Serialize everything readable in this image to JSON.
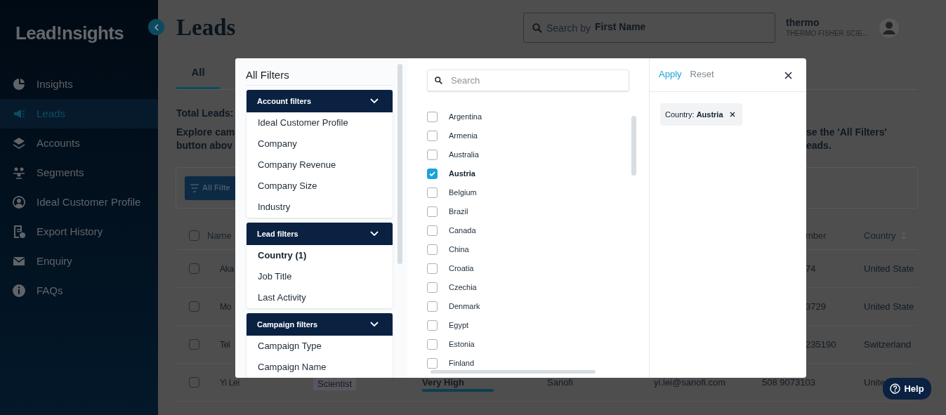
{
  "sidebar": {
    "logo": "Lead!nsights",
    "items": [
      {
        "label": "Insights",
        "selected": false
      },
      {
        "label": "Leads",
        "selected": true
      },
      {
        "label": "Accounts",
        "selected": false
      },
      {
        "label": "Segments",
        "selected": false
      },
      {
        "label": "Ideal Customer Profile",
        "selected": false
      },
      {
        "label": "Export History",
        "selected": false
      },
      {
        "label": "Enquiry",
        "selected": false
      },
      {
        "label": "FAQs",
        "selected": false
      }
    ]
  },
  "header": {
    "title": "Leads",
    "search": {
      "prefix": "Search by",
      "value": "First Name"
    },
    "user": {
      "name": "thermo",
      "org": "THERMO FISHER SCIE..."
    }
  },
  "tabs": [
    {
      "label": "All",
      "selected": true
    }
  ],
  "summary": {
    "total_label": "Total Leads:",
    "left_lines": [
      "Explore cam",
      "button abov"
    ],
    "right_lines": [
      "se the 'All Filters'",
      "eads."
    ]
  },
  "toolbar": {
    "filter_button": "All Filte"
  },
  "table": {
    "select_all_checked": false,
    "columns": [
      {
        "label": "Name"
      },
      {
        "label": "mber"
      },
      {
        "label": "Country"
      }
    ],
    "rows": [
      {
        "checked": false,
        "name": "Aka",
        "phone": "74",
        "country": "United State"
      },
      {
        "checked": false,
        "name": "Mo",
        "phone": "3729",
        "country": "United State"
      },
      {
        "checked": false,
        "name": "Tel",
        "phone": "235190",
        "country": "Switzerland"
      },
      {
        "checked": false,
        "name": "Yi Lei",
        "job_title": "Scientist",
        "score": "Very High",
        "level": 1,
        "company": "Sanofi",
        "email": "yi.lei@sanofi.com",
        "phone": "508 9073103",
        "country": "Unite"
      }
    ]
  },
  "filters_dialog": {
    "title": "All Filters",
    "groups": [
      {
        "label": "Account filters",
        "expanded": true,
        "items": [
          {
            "label": "Ideal Customer Profile",
            "selected": false
          },
          {
            "label": "Company",
            "selected": false
          },
          {
            "label": "Company Revenue",
            "selected": false
          },
          {
            "label": "Company Size",
            "selected": false
          },
          {
            "label": "Industry",
            "selected": false
          }
        ]
      },
      {
        "label": "Lead filters",
        "expanded": true,
        "items": [
          {
            "label": "Country (1)",
            "selected": true
          },
          {
            "label": "Job Title",
            "selected": false
          },
          {
            "label": "Last Activity",
            "selected": false
          }
        ]
      },
      {
        "label": "Campaign filters",
        "expanded": true,
        "items": [
          {
            "label": "Campaign Type",
            "selected": false
          },
          {
            "label": "Campaign Name",
            "selected": false
          }
        ]
      }
    ],
    "search": {
      "placeholder": "Search"
    },
    "countries": [
      {
        "label": "Argentina",
        "checked": false
      },
      {
        "label": "Armenia",
        "checked": false
      },
      {
        "label": "Australia",
        "checked": false
      },
      {
        "label": "Austria",
        "checked": true
      },
      {
        "label": "Belgium",
        "checked": false
      },
      {
        "label": "Brazil",
        "checked": false
      },
      {
        "label": "Canada",
        "checked": false
      },
      {
        "label": "China",
        "checked": false
      },
      {
        "label": "Croatia",
        "checked": false
      },
      {
        "label": "Czechia",
        "checked": false
      },
      {
        "label": "Denmark",
        "checked": false
      },
      {
        "label": "Egypt",
        "checked": false
      },
      {
        "label": "Estonia",
        "checked": false
      },
      {
        "label": "Finland",
        "checked": false
      }
    ],
    "apply": "Apply",
    "reset": "Reset",
    "chips": [
      {
        "text": "Country: **Austria**"
      }
    ]
  },
  "help_button": "Help"
}
